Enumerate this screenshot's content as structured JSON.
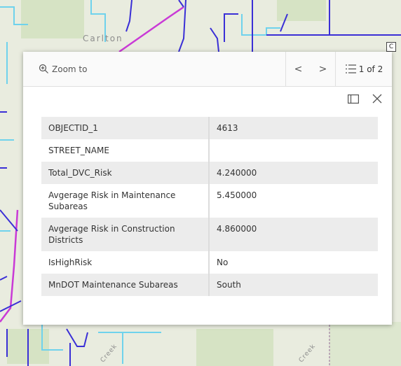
{
  "map": {
    "place_label": "Carlton",
    "marker_label": "C",
    "creek_labels": [
      "Creek",
      "Creek"
    ]
  },
  "popup": {
    "zoom_label": "Zoom to",
    "prev_symbol": "<",
    "next_symbol": ">",
    "page_count": "1 of 2",
    "close_symbol": "×",
    "attributes": [
      {
        "key": "OBJECTID_1",
        "value": "4613"
      },
      {
        "key": "STREET_NAME",
        "value": ""
      },
      {
        "key": "Total_DVC_Risk",
        "value": "4.240000"
      },
      {
        "key": "Avgerage Risk in Maintenance Subareas",
        "value": "5.450000"
      },
      {
        "key": "Avgerage Risk in Construction Districts",
        "value": "4.860000"
      },
      {
        "key": "IsHighRisk",
        "value": "No"
      },
      {
        "key": "MnDOT Maintenance Subareas",
        "value": "South"
      }
    ]
  },
  "colors": {
    "road_primary": "#3a2fd6",
    "road_secondary": "#6fd2ec",
    "road_highlight": "#c93ad6",
    "land": "#e9ecdf",
    "green_area": "#d4e3c2"
  },
  "icons": [
    "zoom-in-icon",
    "list-icon",
    "dock-icon",
    "close-icon"
  ]
}
